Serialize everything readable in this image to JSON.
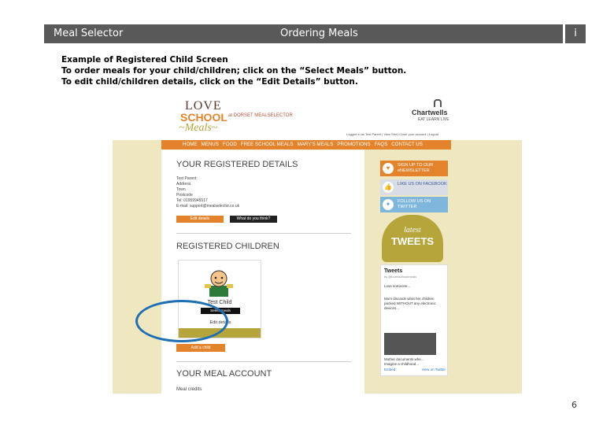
{
  "header": {
    "left_title": "Meal Selector",
    "center_title": "Ordering Meals",
    "info_label": "i"
  },
  "instructions": {
    "line1": "Example of Registered Child Screen",
    "line2": "To order meals for your child/children; click on the “Select Meals” button.",
    "line3": "To edit child/children details, click on the “Edit Details” button."
  },
  "page_number": "6",
  "screenshot": {
    "logo": {
      "love": "LOVE",
      "school": "SCHOOL",
      "meals": "~Meals~"
    },
    "site_tagline": "at DORSET MEALSELECTOR",
    "brand": {
      "name": "Chartwells",
      "sub": "EAT LEARN LIVE"
    },
    "logged_in": "Logged in as Test Parent | View Shit | Close your account | Logout",
    "nav": [
      "HOME",
      "MENUS",
      "FOOD",
      "FREE SCHOOL MEALS",
      "MARY'S MEALS",
      "PROMOTIONS",
      "FAQS",
      "CONTACT US"
    ],
    "registered_details": {
      "title": "YOUR REGISTERED DETAILS",
      "lines": [
        "Test Parent",
        "Address",
        "Town",
        "Postcode",
        "Tel: 01959945517",
        "E-mail: support@mealselector.co.uk"
      ],
      "edit_button": "Edit details",
      "what_button": "What do you think?"
    },
    "registered_children": {
      "title": "REGISTERED CHILDREN",
      "child_name": "Test Child",
      "select_button": "Select meals",
      "edit_button": "Edit details",
      "add_button": "Add a child"
    },
    "meal_account": {
      "title": "YOUR MEAL ACCOUNT",
      "label": "Meal credits"
    },
    "sidebar": {
      "newsletter": "SIGN UP TO OUR eNEWSLETTER",
      "facebook": "LIKE US ON FACEBOOK",
      "twitter": "FOLLOW US ON TWITTER",
      "tweets_badge_l1": "latest",
      "tweets_badge_l2": "TWEETS",
      "tweets_head": "Tweets",
      "tweets_by": "by @lovesschoolmeals",
      "tweet1": "Love someone...",
      "tweet2": "Mum discards what her children packed WITHOUT any electronic devices...",
      "tweet3": "Mother documents whe...",
      "tweet4": "Imagine a childhood...",
      "embed": "Embed",
      "view_on": "View on Twitter"
    }
  }
}
